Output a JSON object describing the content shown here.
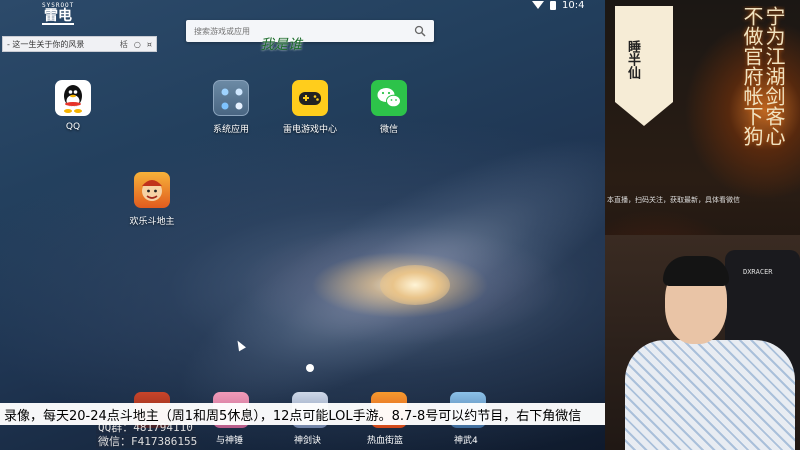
{
  "brand": {
    "top": "SYSROOT",
    "main": "雷电"
  },
  "mini_window": {
    "title": "- 这一生关于你的风景",
    "btn1": "栝",
    "btn2": "○",
    "btn3": "¤"
  },
  "search": {
    "placeholder": "搜索游戏或应用"
  },
  "overlay_title": "我是谁",
  "apps": {
    "qq": "QQ",
    "system_apps": "系统应用",
    "leidian_game_center": "雷电游戏中心",
    "wechat": "微信",
    "happy_landlord": "欢乐斗地主"
  },
  "dock": {
    "item1": "与神锤",
    "item2": "神剑诀",
    "item3": "热血街篮",
    "item4": "神武4"
  },
  "ticker": "录像，每天20-24点斗地主（周1和周5休息），12点可能LOL手游。8.7-8号可以约节目，右下角微信",
  "contact": {
    "qq": "QQ群：481794110",
    "wechat": "微信：F417386155"
  },
  "status": {
    "time": "10:4"
  },
  "side_panel": {
    "banner": "睡半仙",
    "calligraphy": "宁为江湖剑客心不做官府帐下狗",
    "notice": "本直播，扫码关注，获取最新，具体看微信",
    "chair_logo": "DXRACER"
  },
  "colors": {
    "accent_green": "#2dc34a",
    "game_yellow": "#ffcd1c"
  }
}
